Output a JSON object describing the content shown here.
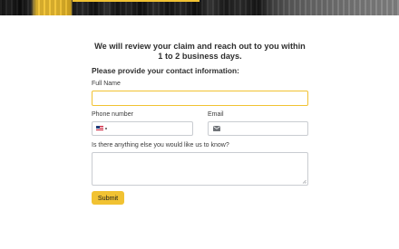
{
  "banner": {
    "colors": {
      "accent": "#f1c232",
      "dark": "#1a1a1a"
    }
  },
  "form": {
    "headline": "We will review your claim and reach out to you within 1 to 2 business days.",
    "section_title": "Please provide your contact information:",
    "full_name": {
      "label": "Full Name",
      "value": "",
      "focused": true
    },
    "phone": {
      "label": "Phone number",
      "value": "",
      "country_flag": "us-flag-icon"
    },
    "email": {
      "label": "Email",
      "value": "",
      "icon": "mail-icon"
    },
    "notes": {
      "label": "Is there anything else you would like us to know?",
      "value": ""
    },
    "submit_label": "Submit"
  },
  "colors": {
    "accent": "#f1c232",
    "border": "#c9ccd1",
    "text": "#2f2f2f"
  }
}
